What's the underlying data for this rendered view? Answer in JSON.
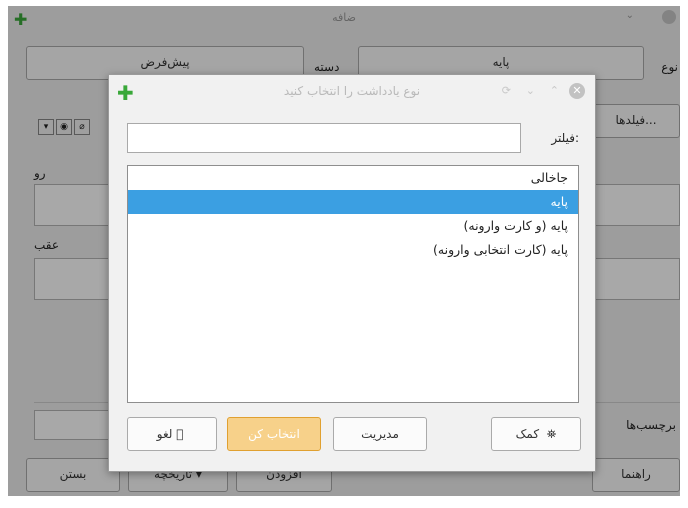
{
  "background_window": {
    "title": "ضافه",
    "type_label": "نوع",
    "type_value": "پایه",
    "deck_label": "دسته",
    "deck_value": "پیش‌فرض",
    "fields_button": "فیلدها...",
    "front_label": "رو",
    "back_label": "عقب",
    "tags_label": "برچسب‌ها",
    "help_button": "راهنما",
    "add_button": "افزودن",
    "history_button": "تاریخچه ▾",
    "close_button": "بستن"
  },
  "dialog": {
    "title": "نوع یادداشت را انتخاب کنید",
    "filter_label": "فیلتر:",
    "filter_value": "",
    "note_types": [
      {
        "label": "جاخالی",
        "selected": false
      },
      {
        "label": "پایه",
        "selected": true
      },
      {
        "label": "پایه (و کارت وارونه)",
        "selected": false
      },
      {
        "label": "پایه (کارت انتخابی وارونه)",
        "selected": false
      }
    ],
    "buttons": {
      "help": "کمک",
      "manage": "مدیریت",
      "choose": "انتخاب کن",
      "cancel": "لغو"
    }
  },
  "colors": {
    "selection": "#3b9fe2",
    "default_button": "#f7d18a",
    "logo_green": "#39a839"
  }
}
